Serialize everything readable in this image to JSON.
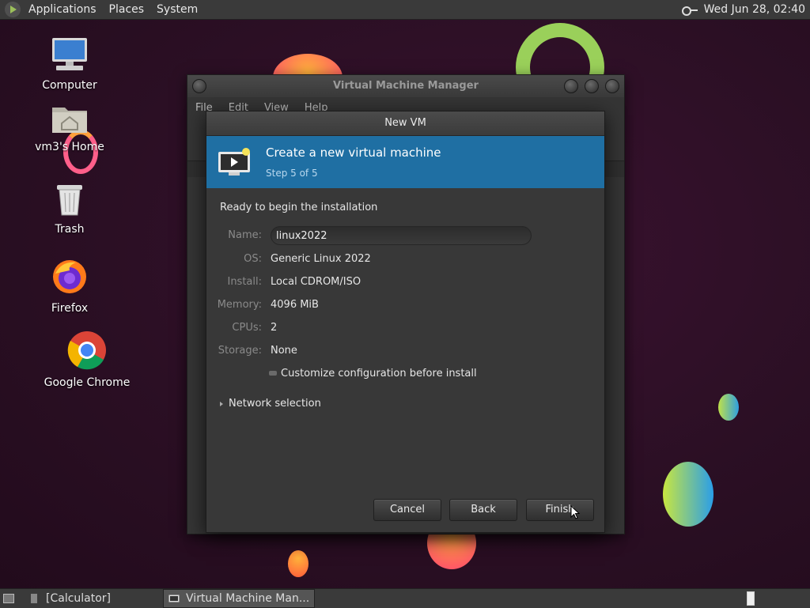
{
  "top_panel": {
    "menus": [
      "Applications",
      "Places",
      "System"
    ],
    "clock": "Wed Jun 28, 02:40"
  },
  "desktop_icons": [
    {
      "label": "Computer",
      "icon": "computer-icon"
    },
    {
      "label": "vm3's Home",
      "icon": "home-folder-icon"
    },
    {
      "label": "Trash",
      "icon": "trash-icon"
    },
    {
      "label": "Firefox",
      "icon": "firefox-icon"
    },
    {
      "label": "Google Chrome",
      "icon": "chrome-icon"
    }
  ],
  "vmm_window": {
    "title": "Virtual Machine Manager",
    "menus": [
      "File",
      "Edit",
      "View",
      "Help"
    ]
  },
  "dialog": {
    "title": "New VM",
    "banner_title": "Create a new virtual machine",
    "banner_step": "Step 5 of 5",
    "ready_text": "Ready to begin the installation",
    "name_label": "Name:",
    "name_value": "linux2022",
    "os_label": "OS:",
    "os_value": "Generic Linux 2022",
    "install_label": "Install:",
    "install_value": "Local CDROM/ISO",
    "memory_label": "Memory:",
    "memory_value": "4096 MiB",
    "cpus_label": "CPUs:",
    "cpus_value": "2",
    "storage_label": "Storage:",
    "storage_value": "None",
    "customize_label": "Customize configuration before install",
    "network_label": "Network selection",
    "cancel_label": "Cancel",
    "back_label": "Back",
    "finish_label": "Finish"
  },
  "taskbar": {
    "items": [
      "[Calculator]",
      "Virtual Machine Man..."
    ]
  },
  "colors": {
    "banner": "#1f6fa3",
    "panel": "#3a3a3a",
    "desktop": "#2b0f24"
  }
}
